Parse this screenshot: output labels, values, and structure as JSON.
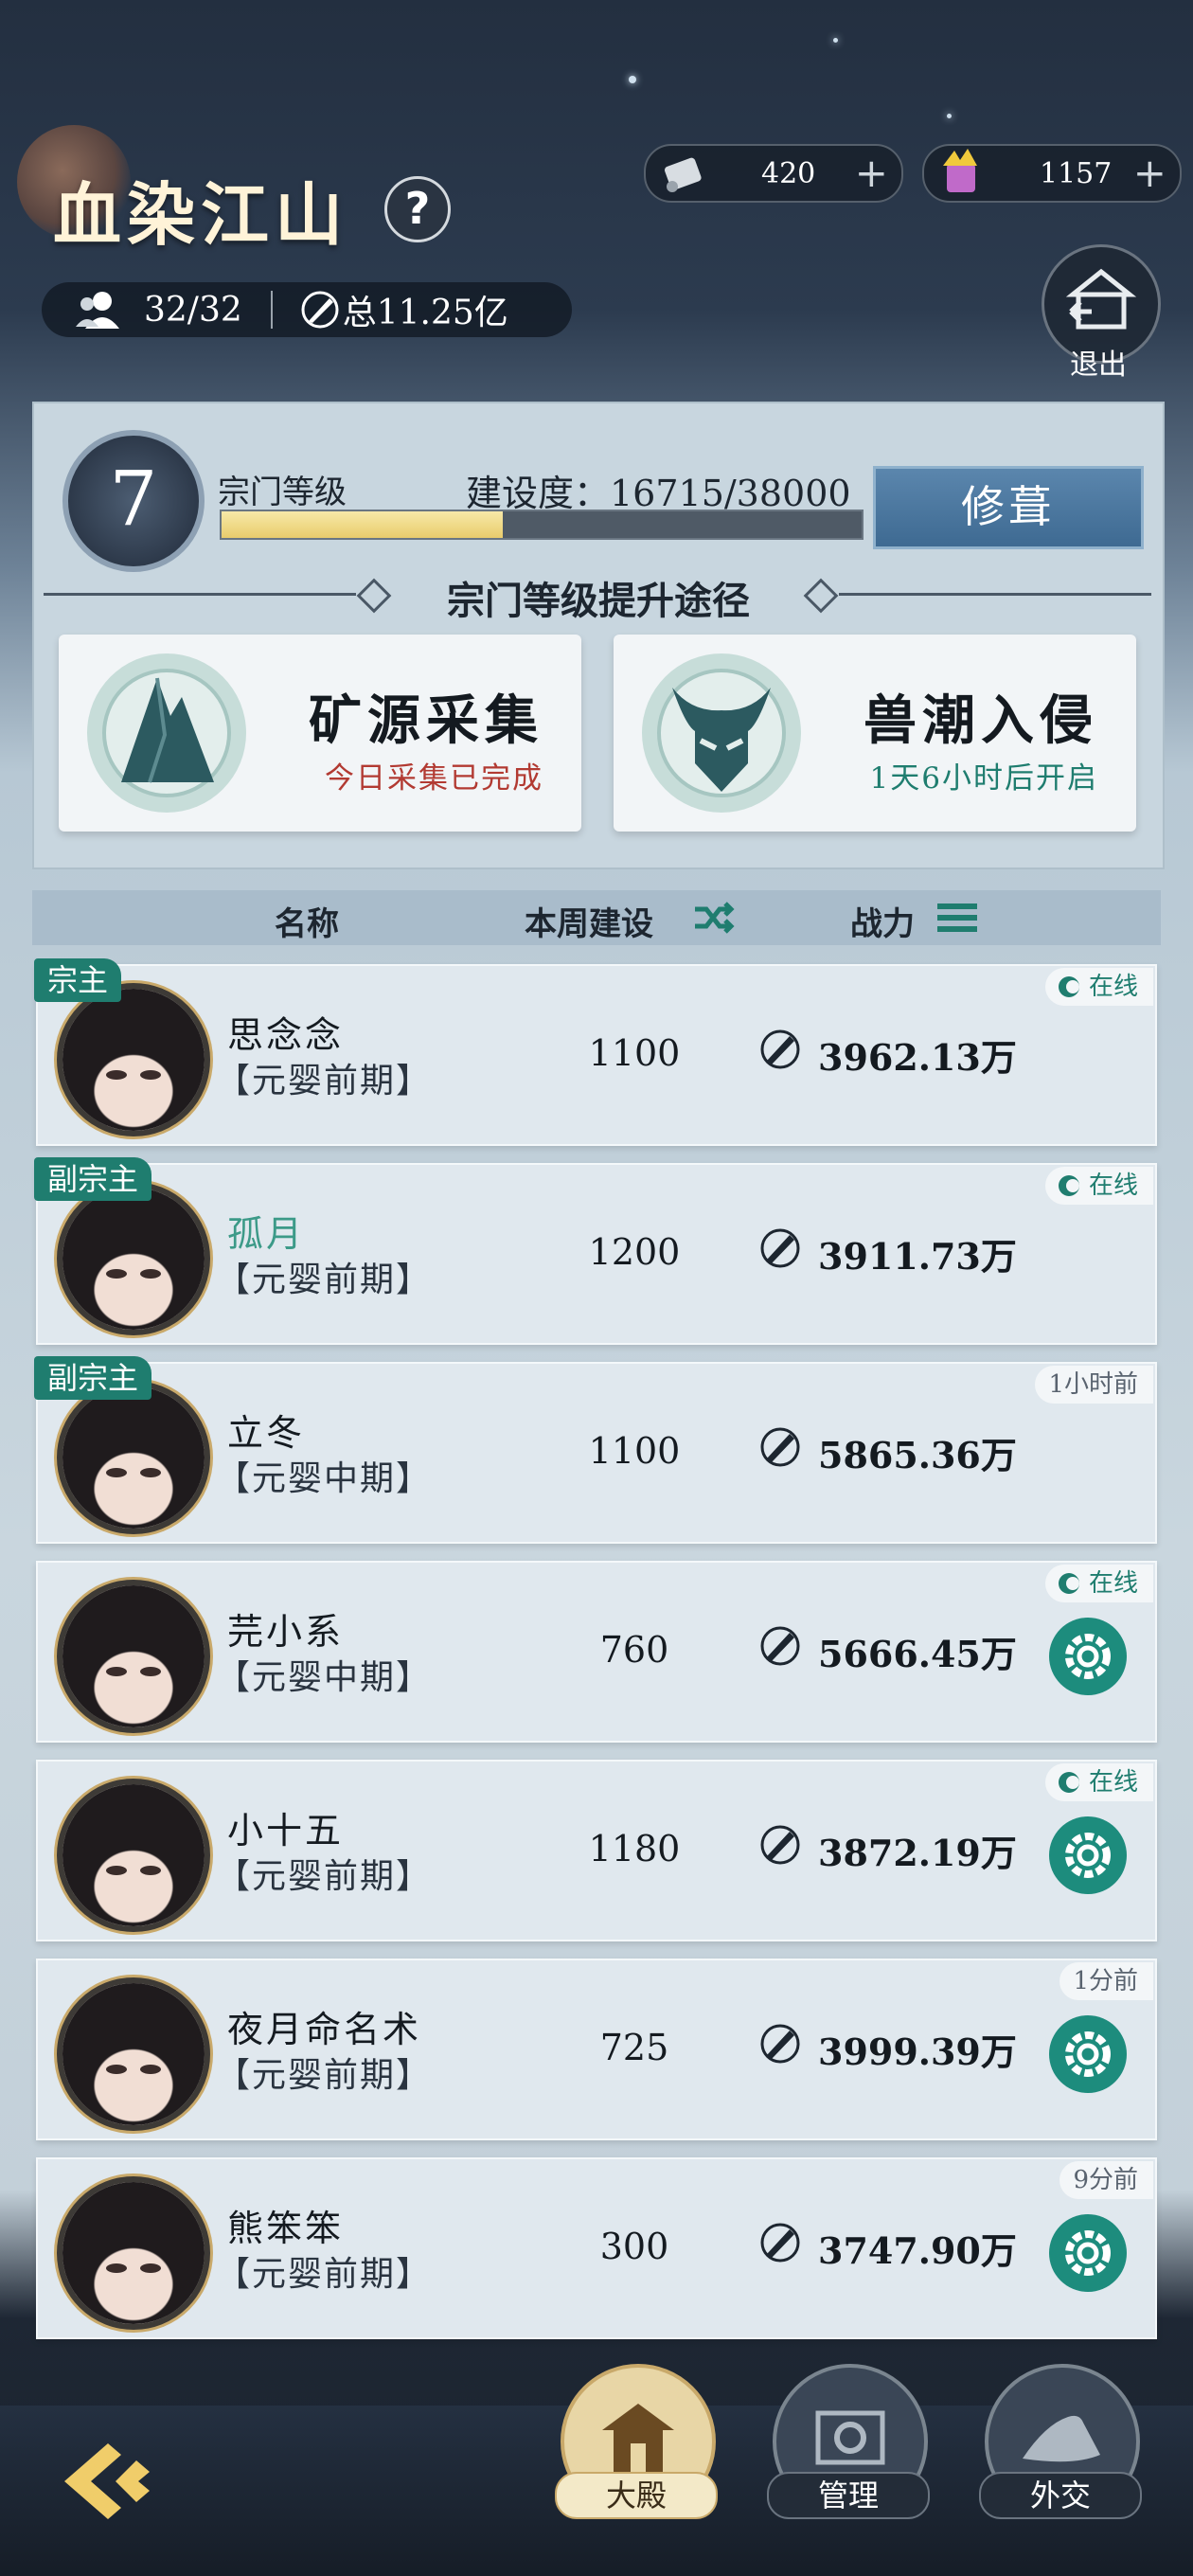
{
  "sect": {
    "name": "血染江山",
    "help": "?",
    "members_count": "32/32",
    "total_power": "总11.25亿"
  },
  "currency": [
    {
      "icon": "scroll-icon",
      "value": "420",
      "plus": "+"
    },
    {
      "icon": "gold-ingot-icon",
      "value": "1157",
      "plus": "+"
    }
  ],
  "exit": {
    "label": "退出"
  },
  "panel": {
    "level": "7",
    "level_label": "宗门等级",
    "build_label": "建设度：16715/38000",
    "build_progress": 0.44,
    "repair_label": "修葺",
    "path_title": "宗门等级提升途径",
    "cards": [
      {
        "title": "矿源采集",
        "subtitle": "今日采集已完成",
        "subtitle_color": "#b23a32"
      },
      {
        "title": "兽潮入侵",
        "subtitle": "1天6小时后开启",
        "subtitle_color": "#1f7d6f"
      }
    ]
  },
  "list_header": {
    "name": "名称",
    "weekly_build": "本周建设",
    "power": "战力"
  },
  "members": [
    {
      "role": "宗主",
      "name": "思念念",
      "realm": "【元婴前期】",
      "build": "1100",
      "power": "3962.13万",
      "status": "在线",
      "online": true,
      "manage": false,
      "highlight": false
    },
    {
      "role": "副宗主",
      "name": "孤月",
      "realm": "【元婴前期】",
      "build": "1200",
      "power": "3911.73万",
      "status": "在线",
      "online": true,
      "manage": false,
      "highlight": true
    },
    {
      "role": "副宗主",
      "name": "立冬",
      "realm": "【元婴中期】",
      "build": "1100",
      "power": "5865.36万",
      "status": "1小时前",
      "online": false,
      "manage": false,
      "highlight": false
    },
    {
      "role": "",
      "name": "芫小系",
      "realm": "【元婴中期】",
      "build": "760",
      "power": "5666.45万",
      "status": "在线",
      "online": true,
      "manage": true,
      "highlight": false
    },
    {
      "role": "",
      "name": "小十五",
      "realm": "【元婴前期】",
      "build": "1180",
      "power": "3872.19万",
      "status": "在线",
      "online": true,
      "manage": true,
      "highlight": false
    },
    {
      "role": "",
      "name": "夜月命名术",
      "realm": "【元婴前期】",
      "build": "725",
      "power": "3999.39万",
      "status": "1分前",
      "online": false,
      "manage": true,
      "highlight": false
    },
    {
      "role": "",
      "name": "熊笨笨",
      "realm": "【元婴前期】",
      "build": "300",
      "power": "3747.90万",
      "status": "9分前",
      "online": false,
      "manage": true,
      "highlight": false
    }
  ],
  "nav": [
    {
      "label": "大殿",
      "icon": "hall-icon",
      "active": true
    },
    {
      "label": "管理",
      "icon": "manage-icon",
      "active": false
    },
    {
      "label": "外交",
      "icon": "diplomacy-icon",
      "active": false
    }
  ],
  "colors": {
    "accent": "#1f7d6f",
    "warning": "#b23a32",
    "progress": "#e9cc6c"
  }
}
